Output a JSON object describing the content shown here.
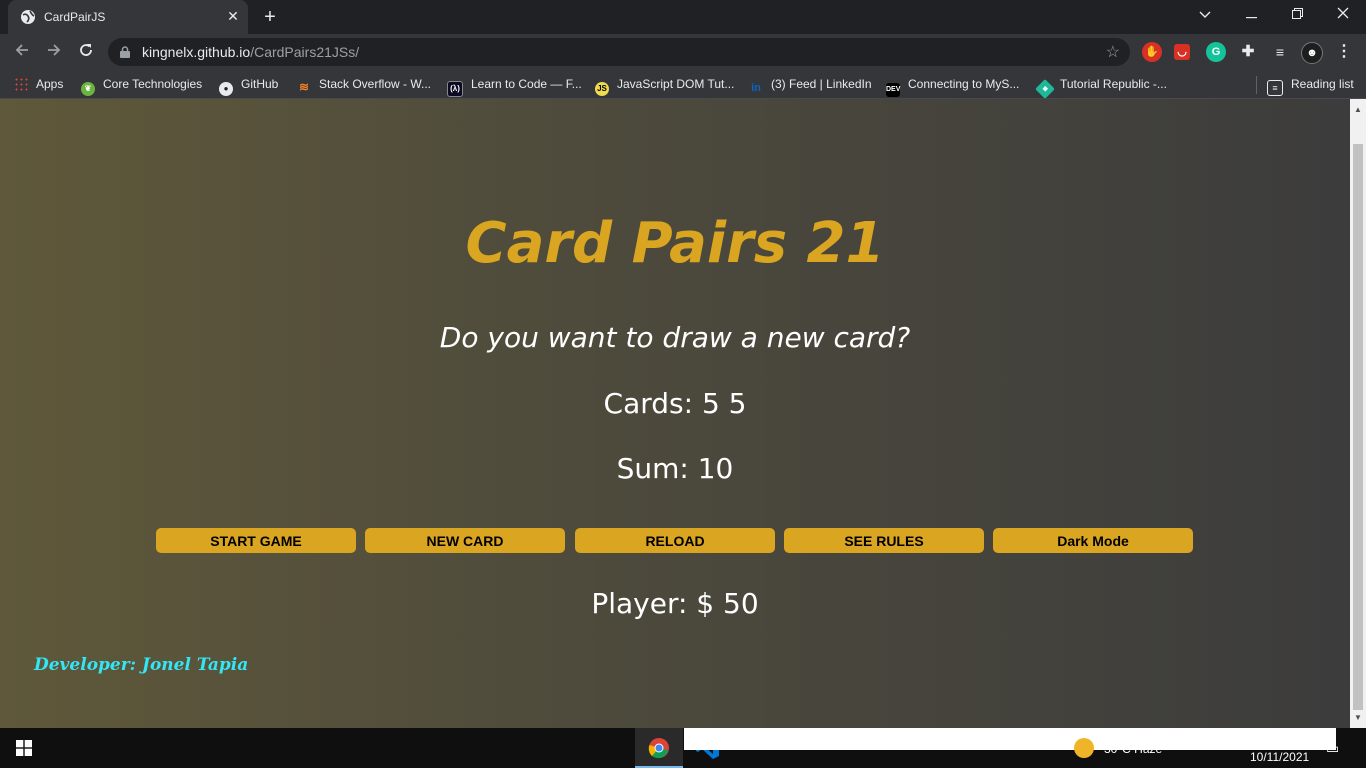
{
  "browser": {
    "tab": {
      "title": "CardPairJS"
    },
    "address": {
      "host": "kingnelx.github.io",
      "path": "/CardPairs21JSs/"
    },
    "bookmarks": [
      {
        "label": "Apps",
        "icon": "apps-grid-icon"
      },
      {
        "label": "Core Technologies",
        "icon": "spring-icon"
      },
      {
        "label": "GitHub",
        "icon": "github-icon"
      },
      {
        "label": "Stack Overflow - W...",
        "icon": "stackoverflow-icon"
      },
      {
        "label": "Learn to Code — F...",
        "icon": "freecodecamp-icon"
      },
      {
        "label": "JavaScript DOM Tut...",
        "icon": "js-icon"
      },
      {
        "label": "(3) Feed | LinkedIn",
        "icon": "linkedin-icon"
      },
      {
        "label": "Connecting to MyS...",
        "icon": "dev-icon"
      },
      {
        "label": "Tutorial Republic -...",
        "icon": "tutorialrepublic-icon"
      }
    ],
    "reading_list": "Reading list"
  },
  "game": {
    "title": "Card Pairs 21",
    "message": "Do you want to draw a new card?",
    "cards": "Cards: 5 5",
    "sum": "Sum: 10",
    "buttons": {
      "start": "START GAME",
      "new_card": "NEW CARD",
      "reload": "RELOAD",
      "rules": "SEE RULES",
      "dark_mode": "Dark Mode"
    },
    "player": "Player: $ 50",
    "developer": "Developer: Jonel Tapia"
  },
  "taskbar": {
    "weather": "30°C  Haze",
    "date": "10/11/2021"
  },
  "colors": {
    "accent": "#daa520",
    "developer_text": "#33e6f5"
  }
}
